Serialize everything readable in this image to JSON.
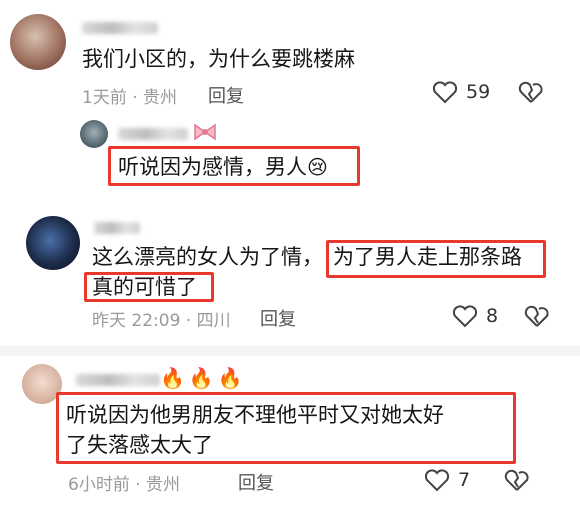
{
  "comments": [
    {
      "text": "我们小区的，为什么要跳楼麻",
      "meta": "1天前 · 贵州",
      "reply": "回复",
      "likes": "59"
    },
    {
      "text": "听说因为感情，男人",
      "emoji": "😢"
    },
    {
      "line1_part1": "这么漂亮的女人为了情，",
      "line1_part2": "为了男人走上那条路",
      "line2": "真的可惜了",
      "meta": "昨天 22:09 · 四川",
      "reply": "回复",
      "likes": "8"
    },
    {
      "name_emoji": "🔥🔥🔥",
      "line1": "听说因为他男朋友不理他平时又对她太好",
      "line2": "了失落感太大了",
      "meta": "6小时前 · 贵州",
      "reply": "回复",
      "likes": "7"
    }
  ],
  "colors": {
    "highlight": "#e8392f",
    "meta": "#9a9a9a"
  }
}
